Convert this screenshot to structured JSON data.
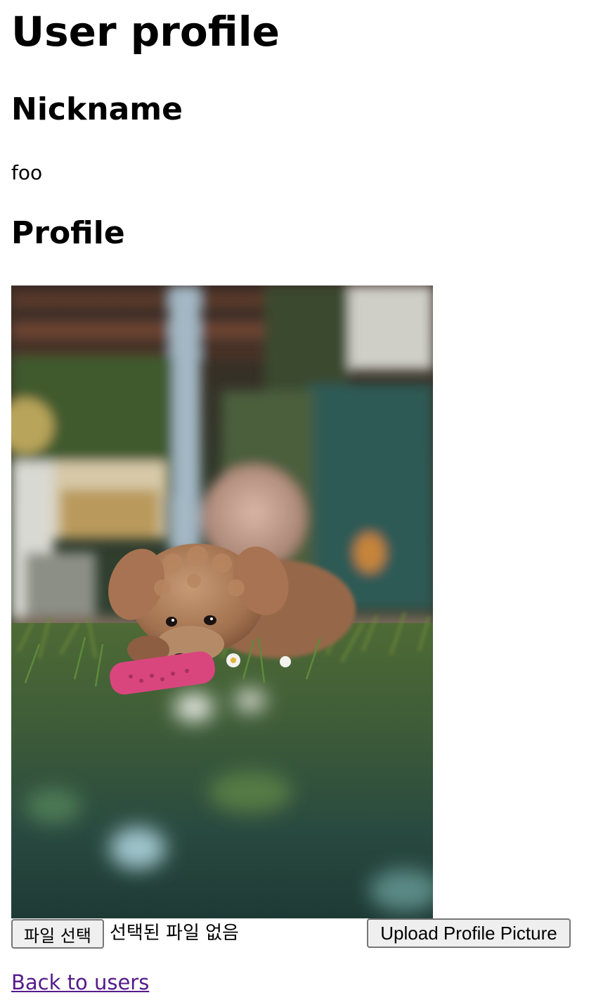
{
  "page": {
    "title": "User profile"
  },
  "nickname": {
    "heading": "Nickname",
    "value": "foo"
  },
  "profile": {
    "heading": "Profile",
    "photo_subject": "dog-photo"
  },
  "upload_form": {
    "choose_file_label": "파일 선택",
    "no_file_text": "선택된 파일 없음",
    "submit_label": "Upload Profile Picture"
  },
  "nav": {
    "back_label": "Back to users"
  },
  "colors": {
    "link_visited": "#551a8b",
    "button_bg": "#efefef",
    "button_border": "#767676"
  }
}
